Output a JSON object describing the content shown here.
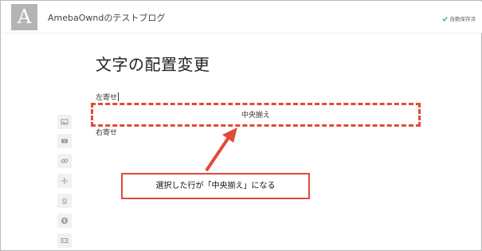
{
  "header": {
    "logo_letter": "A",
    "blog_title": "AmebaOwndのテストブログ",
    "save_status": "自動保存済"
  },
  "toolbar": {
    "items": [
      {
        "icon": "image-icon"
      },
      {
        "icon": "video-icon"
      },
      {
        "icon": "link-icon"
      },
      {
        "icon": "divider-icon"
      },
      {
        "icon": "amazon-icon"
      },
      {
        "icon": "dollar-icon"
      },
      {
        "icon": "code-icon"
      }
    ]
  },
  "editor": {
    "title": "文字の配置変更",
    "paragraphs": {
      "left": "左寄せ",
      "center": "中央揃え",
      "right": "右寄せ"
    }
  },
  "annotation": {
    "callout_text": "選択した行が「中央揃え」になる",
    "color": "#e04a3a"
  }
}
